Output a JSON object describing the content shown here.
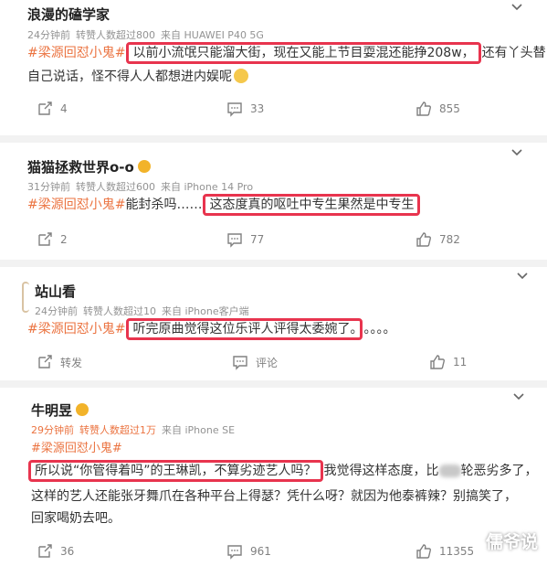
{
  "posts": [
    {
      "username": "浪漫的磕学家",
      "meta_time": "24分钟前",
      "meta_reposts": "转赞人数超过800",
      "meta_source": "来自 HUAWEI P40 5G",
      "tag": "#梁源回怼小鬼#",
      "highlight": "以前小流氓只能溜大街，现在又能上节目耍混还能挣208w，",
      "line1_rest": "还有丫头替",
      "line2": "自己说话，怪不得人人都想进内娱呢",
      "repost_count": "4",
      "comment_count": "33",
      "like_count": "855"
    },
    {
      "username": "猫猫拯救世界o-o",
      "meta_time": "31分钟前",
      "meta_reposts": "转赞人数超过600",
      "meta_source": "来自 iPhone 14 Pro",
      "tag": "#梁源回怼小鬼#",
      "pre": "能封杀吗……",
      "highlight": "这态度真的呕吐中专生果然是中专生",
      "repost_count": "2",
      "comment_count": "77",
      "like_count": "782"
    },
    {
      "username": "站山看",
      "meta_time": "24分钟前",
      "meta_reposts": "转赞人数超过10",
      "meta_source": "来自 iPhone客户端",
      "tag": "#梁源回怼小鬼#",
      "highlight": "听完原曲觉得这位乐评人评得太委婉了。",
      "post_text": "。。。。",
      "repost_label": "转发",
      "comment_label": "评论",
      "like_count": "11"
    },
    {
      "username": "牛明昱",
      "meta_time": "29分钟前",
      "meta_reposts": "转赞人数超过1万",
      "meta_source": "来自 iPhone SE",
      "tag": "#梁源回怼小鬼#",
      "highlight": "所以说“你管得着吗”的王琳凯，不算劣迹艺人吗？",
      "line1_rest_a": "我觉得这样态度，比",
      "line1_rest_b": "轮恶劣多了，",
      "line2": "这样的艺人还能张牙舞爪在各种平台上得瑟？凭什么呀？就因为他泰裤辣？别搞笑了，",
      "line3": "回家喝奶去吧。",
      "repost_count": "36",
      "comment_count": "961",
      "like_count": "11355"
    }
  ],
  "watermark": "儒爷说",
  "colors": {
    "tag": "#eb7340",
    "highlight_border": "#e8344e",
    "meta": "#939393",
    "hot_meta": "#eb7340"
  },
  "icons": [
    "repost-icon",
    "comment-icon",
    "like-icon",
    "chevron-down-icon",
    "badge-icon",
    "emoji-icon"
  ]
}
